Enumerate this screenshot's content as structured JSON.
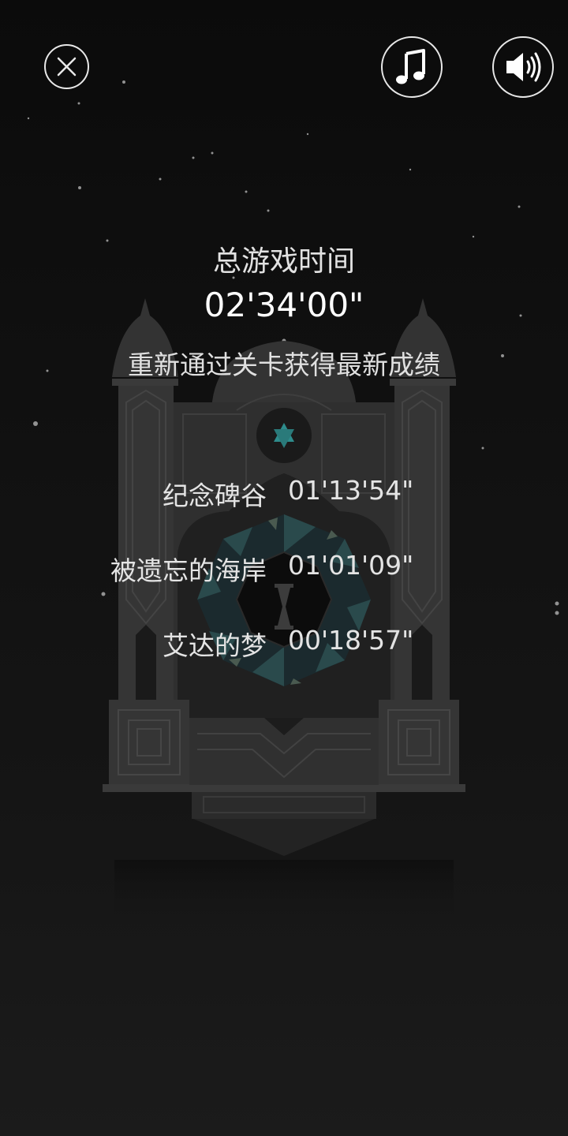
{
  "controls": {
    "close_icon": "close-icon",
    "music_icon": "music-note-icon",
    "sound_icon": "speaker-icon"
  },
  "summary": {
    "total_label": "总游戏时间",
    "total_time": "02'34'00\"",
    "hint": "重新通过关卡获得最新成绩"
  },
  "chapters": [
    {
      "name": "纪念碑谷",
      "time": "01'13'54\""
    },
    {
      "name": "被遗忘的海岸",
      "time": "01'01'09\""
    },
    {
      "name": "艾达的梦",
      "time": "00'18'57\""
    }
  ],
  "colors": {
    "background": "#121212",
    "text": "#e6e6e6",
    "temple_stone": "#3a3a3a",
    "gem": "#2e8c8c"
  }
}
